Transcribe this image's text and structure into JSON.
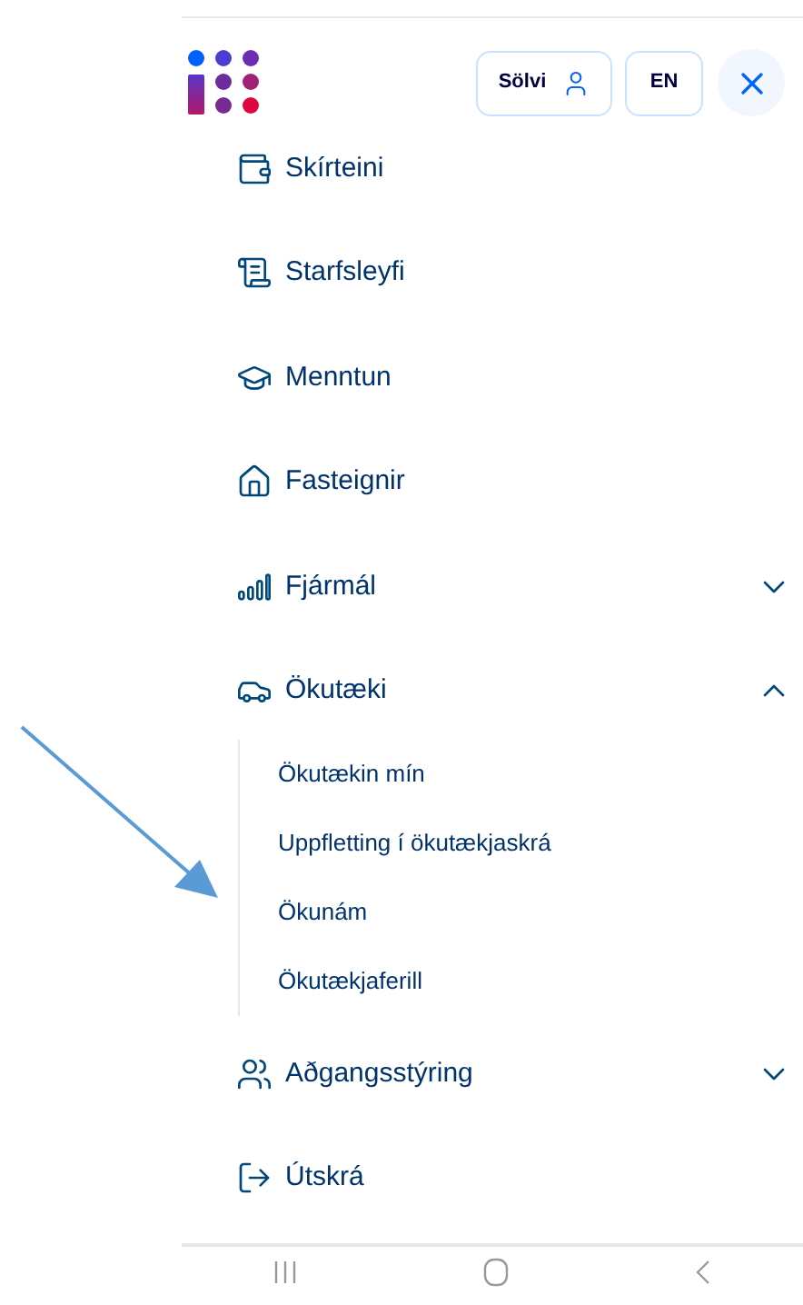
{
  "header": {
    "user_button": "Sölvi",
    "language_button": "EN"
  },
  "menu": [
    {
      "kind": "link",
      "label": "Skírteini"
    },
    {
      "kind": "link",
      "label": "Starfsleyfi"
    },
    {
      "kind": "link",
      "label": "Menntun"
    },
    {
      "kind": "link",
      "label": "Fasteignir"
    },
    {
      "kind": "group",
      "label": "Fjármál",
      "expanded": false
    },
    {
      "kind": "group",
      "label": "Ökutæki",
      "expanded": true,
      "children": [
        {
          "label": "Ökutækin mín"
        },
        {
          "label": "Uppfletting í ökutækjaskrá"
        },
        {
          "label": "Ökunám"
        },
        {
          "label": "Ökutækjaferill"
        }
      ]
    },
    {
      "kind": "group",
      "label": "Aðgangsstýring",
      "expanded": false
    },
    {
      "kind": "link",
      "label": "Útskrá"
    }
  ]
}
